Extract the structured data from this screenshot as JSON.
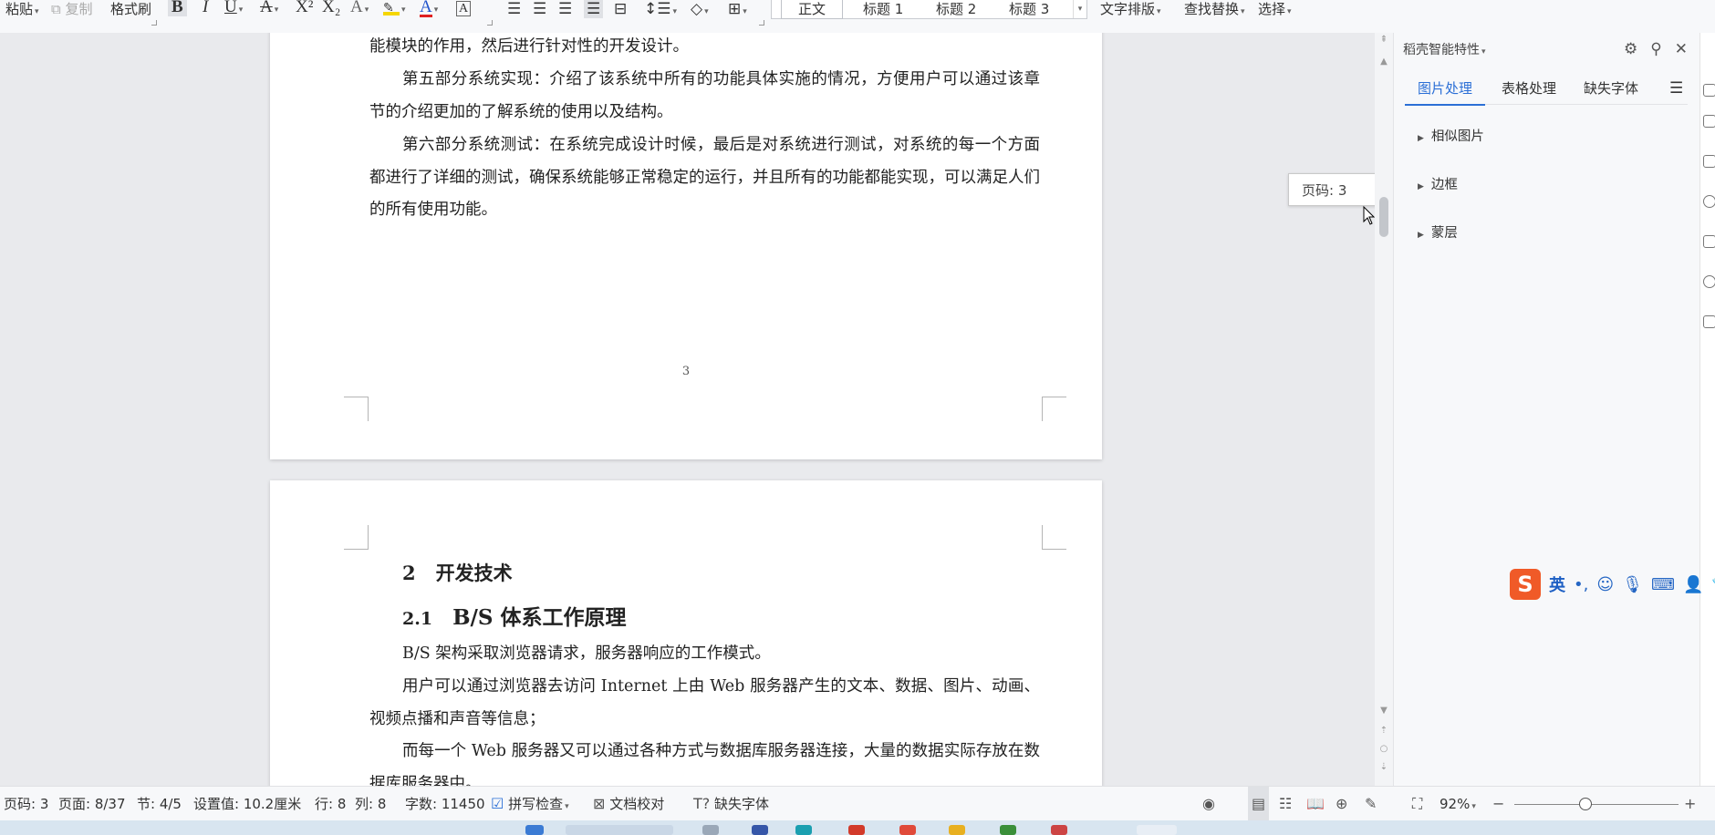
{
  "ribbon": {
    "paste": "粘贴",
    "copy": "复制",
    "format_painter": "格式刷",
    "bold": "B",
    "italic": "I",
    "underline": "U",
    "strike": "A",
    "superscript": "X²",
    "subscript": "X₂",
    "text_effect": "A",
    "font_color": "A",
    "char_border": "A",
    "styles": [
      "正文",
      "标题 1",
      "标题 2",
      "标题 3"
    ],
    "text_layout": "文字排版",
    "find_replace": "查找替换",
    "select": "选择"
  },
  "document": {
    "page1_paragraphs": [
      "能模块的作用，然后进行针对性的开发设计。",
      "第五部分系统实现：介绍了该系统中所有的功能具体实施的情况，方便用户可以通过该章节的介绍更加的了解系统的使用以及结构。",
      "第六部分系统测试：在系统完成设计时候，最后是对系统进行测试，对系统的每一个方面都进行了详细的测试，确保系统能够正常稳定的运行，并且所有的功能都能实现，可以满足人们的所有使用功能。"
    ],
    "page1_number": "3",
    "heading1_num": "2",
    "heading1_text": "开发技术",
    "heading2_num": "2.1",
    "heading2_text": "B/S 体系工作原理",
    "page2_paragraphs": [
      "B/S 架构采取浏览器请求，服务器响应的工作模式。",
      "用户可以通过浏览器去访问 Internet 上由 Web 服务器产生的文本、数据、图片、动画、视频点播和声音等信息；",
      "而每一个 Web 服务器又可以通过各种方式与数据库服务器连接，大量的数据实际存放在数据库服务器中。"
    ]
  },
  "tooltip": {
    "text": "页码: 3"
  },
  "panel": {
    "title": "稻壳智能特性",
    "tabs": [
      "图片处理",
      "表格处理",
      "缺失字体"
    ],
    "items": [
      "相似图片",
      "边框",
      "蒙层"
    ]
  },
  "ime": {
    "lang": "英"
  },
  "status": {
    "page_code": "页码: 3",
    "page": "页面: 8/37",
    "section": "节: 4/5",
    "setting": "设置值: 10.2厘米",
    "row": "行: 8",
    "col": "列: 8",
    "word_count": "字数: 11450",
    "spell_check": "拼写检查",
    "doc_proof": "文档校对",
    "missing_font": "缺失字体",
    "zoom": "92%"
  },
  "colors": {
    "accent": "#2b6fd6",
    "ime_logo": "#f05a28"
  }
}
